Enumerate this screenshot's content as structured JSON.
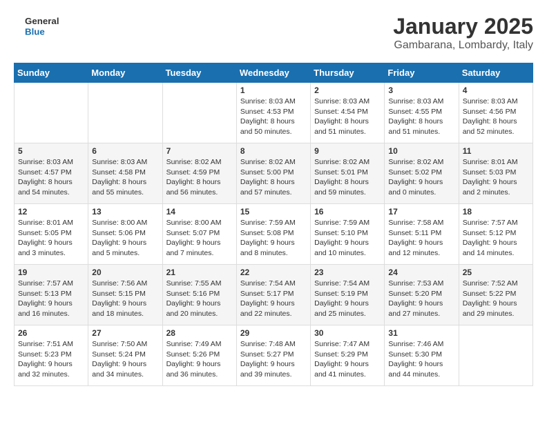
{
  "logo": {
    "line1": "General",
    "line2": "Blue"
  },
  "header": {
    "month_year": "January 2025",
    "location": "Gambarana, Lombardy, Italy"
  },
  "weekdays": [
    "Sunday",
    "Monday",
    "Tuesday",
    "Wednesday",
    "Thursday",
    "Friday",
    "Saturday"
  ],
  "weeks": [
    [
      {
        "day": "",
        "sunrise": "",
        "sunset": "",
        "daylight": ""
      },
      {
        "day": "",
        "sunrise": "",
        "sunset": "",
        "daylight": ""
      },
      {
        "day": "",
        "sunrise": "",
        "sunset": "",
        "daylight": ""
      },
      {
        "day": "1",
        "sunrise": "Sunrise: 8:03 AM",
        "sunset": "Sunset: 4:53 PM",
        "daylight": "Daylight: 8 hours and 50 minutes."
      },
      {
        "day": "2",
        "sunrise": "Sunrise: 8:03 AM",
        "sunset": "Sunset: 4:54 PM",
        "daylight": "Daylight: 8 hours and 51 minutes."
      },
      {
        "day": "3",
        "sunrise": "Sunrise: 8:03 AM",
        "sunset": "Sunset: 4:55 PM",
        "daylight": "Daylight: 8 hours and 51 minutes."
      },
      {
        "day": "4",
        "sunrise": "Sunrise: 8:03 AM",
        "sunset": "Sunset: 4:56 PM",
        "daylight": "Daylight: 8 hours and 52 minutes."
      }
    ],
    [
      {
        "day": "5",
        "sunrise": "Sunrise: 8:03 AM",
        "sunset": "Sunset: 4:57 PM",
        "daylight": "Daylight: 8 hours and 54 minutes."
      },
      {
        "day": "6",
        "sunrise": "Sunrise: 8:03 AM",
        "sunset": "Sunset: 4:58 PM",
        "daylight": "Daylight: 8 hours and 55 minutes."
      },
      {
        "day": "7",
        "sunrise": "Sunrise: 8:02 AM",
        "sunset": "Sunset: 4:59 PM",
        "daylight": "Daylight: 8 hours and 56 minutes."
      },
      {
        "day": "8",
        "sunrise": "Sunrise: 8:02 AM",
        "sunset": "Sunset: 5:00 PM",
        "daylight": "Daylight: 8 hours and 57 minutes."
      },
      {
        "day": "9",
        "sunrise": "Sunrise: 8:02 AM",
        "sunset": "Sunset: 5:01 PM",
        "daylight": "Daylight: 8 hours and 59 minutes."
      },
      {
        "day": "10",
        "sunrise": "Sunrise: 8:02 AM",
        "sunset": "Sunset: 5:02 PM",
        "daylight": "Daylight: 9 hours and 0 minutes."
      },
      {
        "day": "11",
        "sunrise": "Sunrise: 8:01 AM",
        "sunset": "Sunset: 5:03 PM",
        "daylight": "Daylight: 9 hours and 2 minutes."
      }
    ],
    [
      {
        "day": "12",
        "sunrise": "Sunrise: 8:01 AM",
        "sunset": "Sunset: 5:05 PM",
        "daylight": "Daylight: 9 hours and 3 minutes."
      },
      {
        "day": "13",
        "sunrise": "Sunrise: 8:00 AM",
        "sunset": "Sunset: 5:06 PM",
        "daylight": "Daylight: 9 hours and 5 minutes."
      },
      {
        "day": "14",
        "sunrise": "Sunrise: 8:00 AM",
        "sunset": "Sunset: 5:07 PM",
        "daylight": "Daylight: 9 hours and 7 minutes."
      },
      {
        "day": "15",
        "sunrise": "Sunrise: 7:59 AM",
        "sunset": "Sunset: 5:08 PM",
        "daylight": "Daylight: 9 hours and 8 minutes."
      },
      {
        "day": "16",
        "sunrise": "Sunrise: 7:59 AM",
        "sunset": "Sunset: 5:10 PM",
        "daylight": "Daylight: 9 hours and 10 minutes."
      },
      {
        "day": "17",
        "sunrise": "Sunrise: 7:58 AM",
        "sunset": "Sunset: 5:11 PM",
        "daylight": "Daylight: 9 hours and 12 minutes."
      },
      {
        "day": "18",
        "sunrise": "Sunrise: 7:57 AM",
        "sunset": "Sunset: 5:12 PM",
        "daylight": "Daylight: 9 hours and 14 minutes."
      }
    ],
    [
      {
        "day": "19",
        "sunrise": "Sunrise: 7:57 AM",
        "sunset": "Sunset: 5:13 PM",
        "daylight": "Daylight: 9 hours and 16 minutes."
      },
      {
        "day": "20",
        "sunrise": "Sunrise: 7:56 AM",
        "sunset": "Sunset: 5:15 PM",
        "daylight": "Daylight: 9 hours and 18 minutes."
      },
      {
        "day": "21",
        "sunrise": "Sunrise: 7:55 AM",
        "sunset": "Sunset: 5:16 PM",
        "daylight": "Daylight: 9 hours and 20 minutes."
      },
      {
        "day": "22",
        "sunrise": "Sunrise: 7:54 AM",
        "sunset": "Sunset: 5:17 PM",
        "daylight": "Daylight: 9 hours and 22 minutes."
      },
      {
        "day": "23",
        "sunrise": "Sunrise: 7:54 AM",
        "sunset": "Sunset: 5:19 PM",
        "daylight": "Daylight: 9 hours and 25 minutes."
      },
      {
        "day": "24",
        "sunrise": "Sunrise: 7:53 AM",
        "sunset": "Sunset: 5:20 PM",
        "daylight": "Daylight: 9 hours and 27 minutes."
      },
      {
        "day": "25",
        "sunrise": "Sunrise: 7:52 AM",
        "sunset": "Sunset: 5:22 PM",
        "daylight": "Daylight: 9 hours and 29 minutes."
      }
    ],
    [
      {
        "day": "26",
        "sunrise": "Sunrise: 7:51 AM",
        "sunset": "Sunset: 5:23 PM",
        "daylight": "Daylight: 9 hours and 32 minutes."
      },
      {
        "day": "27",
        "sunrise": "Sunrise: 7:50 AM",
        "sunset": "Sunset: 5:24 PM",
        "daylight": "Daylight: 9 hours and 34 minutes."
      },
      {
        "day": "28",
        "sunrise": "Sunrise: 7:49 AM",
        "sunset": "Sunset: 5:26 PM",
        "daylight": "Daylight: 9 hours and 36 minutes."
      },
      {
        "day": "29",
        "sunrise": "Sunrise: 7:48 AM",
        "sunset": "Sunset: 5:27 PM",
        "daylight": "Daylight: 9 hours and 39 minutes."
      },
      {
        "day": "30",
        "sunrise": "Sunrise: 7:47 AM",
        "sunset": "Sunset: 5:29 PM",
        "daylight": "Daylight: 9 hours and 41 minutes."
      },
      {
        "day": "31",
        "sunrise": "Sunrise: 7:46 AM",
        "sunset": "Sunset: 5:30 PM",
        "daylight": "Daylight: 9 hours and 44 minutes."
      },
      {
        "day": "",
        "sunrise": "",
        "sunset": "",
        "daylight": ""
      }
    ]
  ]
}
